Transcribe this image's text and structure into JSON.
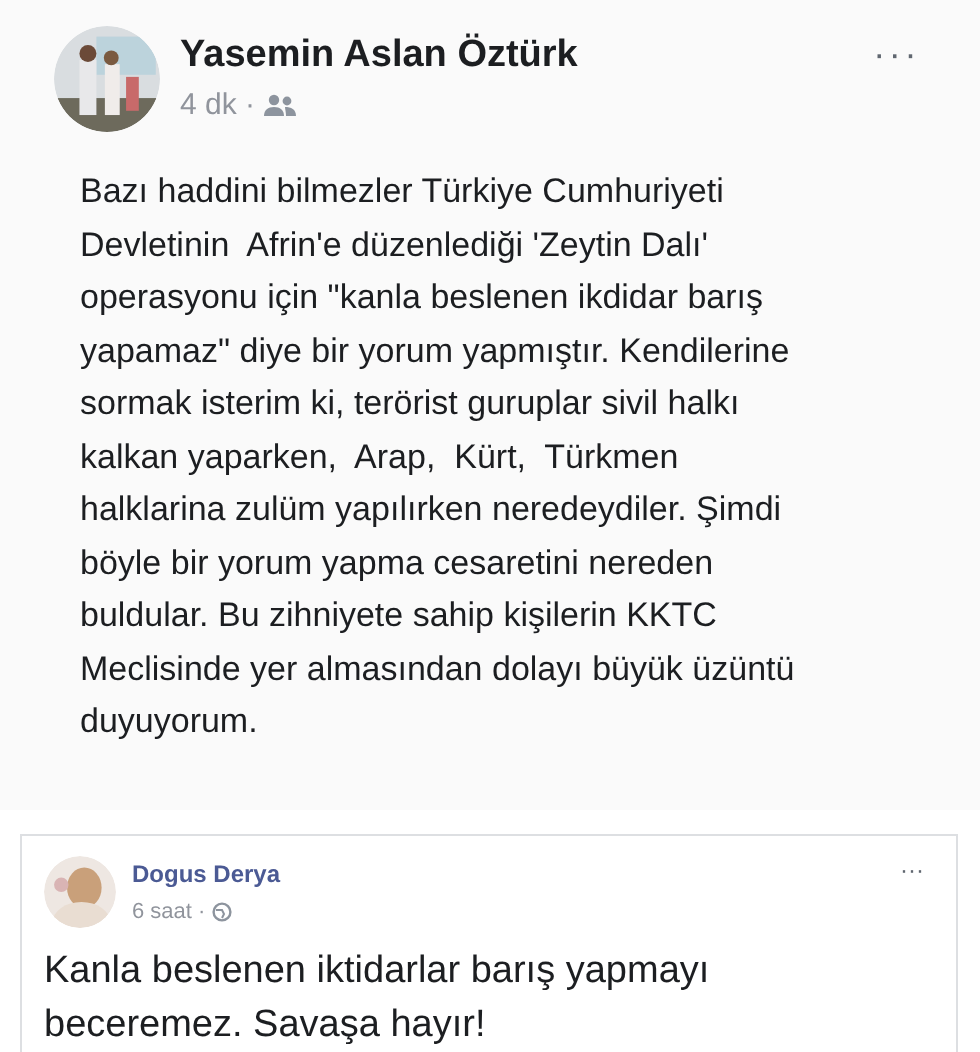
{
  "posts": [
    {
      "author": "Yasemin Aslan Öztürk",
      "time": "4 dk",
      "separator": "·",
      "audience": {
        "kind": "friends"
      },
      "more": "···",
      "body_lines": [
        "Bazı haddini bilmezler Türkiye Cumhuriyeti",
        "Devletinin  Afrin'e düzenlediği 'Zeytin Dalı'",
        "operasyonu için \"kanla beslenen ikdidar barış",
        "yapamaz\" diye bir yorum yapmıştır. Kendilerine",
        "sormak isterim ki, terörist guruplar sivil halkı",
        "kalkan yaparken,  Arap,  Kürt,  Türkmen",
        "halklarina zulüm yapılırken neredeydiler. Şimdi",
        "böyle bir yorum yapma cesaretini nereden",
        "buldular. Bu zihniyete sahip kişilerin KKTC",
        "Meclisinde yer almasından dolayı büyük üzüntü",
        "duyuyorum."
      ]
    },
    {
      "author": "Dogus Derya",
      "time": "6 saat",
      "separator": "·",
      "audience": {
        "kind": "public"
      },
      "more": "···",
      "body_lines": [
        "Kanla beslenen iktidarlar barış yapmayı",
        "beceremez. Savaşa hayır!"
      ]
    }
  ]
}
